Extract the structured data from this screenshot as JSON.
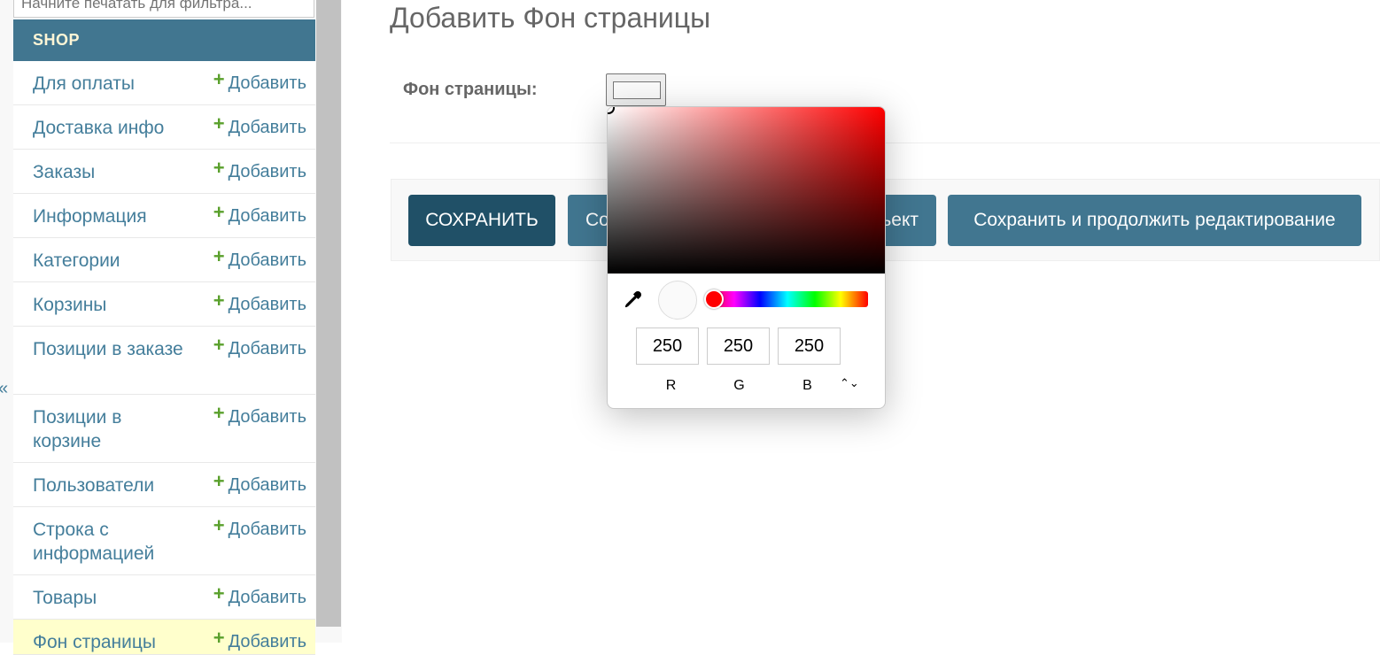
{
  "sidebar": {
    "filter_placeholder": "Начните печатать для фильтра...",
    "app_name": "SHOP",
    "add_label": "Добавить",
    "collapse_glyph": "«",
    "items": [
      {
        "label": "Для оплаты"
      },
      {
        "label": "Доставка инфо"
      },
      {
        "label": "Заказы"
      },
      {
        "label": "Информация"
      },
      {
        "label": "Категории"
      },
      {
        "label": "Корзины"
      },
      {
        "label": "Позиции в заказе"
      },
      {
        "label": "Позиции в корзине"
      },
      {
        "label": "Пользователи"
      },
      {
        "label": "Строка с информацией"
      },
      {
        "label": "Товары"
      },
      {
        "label": "Фон страницы",
        "active": true
      }
    ]
  },
  "main": {
    "title": "Добавить Фон страницы",
    "field_label": "Фон страницы:",
    "field_value": "#fafafa",
    "buttons": {
      "save": "СОХРАНИТЬ",
      "save_add_left": "Со",
      "save_add_right": "ьект",
      "save_continue": "Сохранить и продолжить редактирование"
    }
  },
  "color_picker": {
    "hue_color": "#ff0000",
    "preview_color": "#fafafa",
    "r": "250",
    "g": "250",
    "b": "250",
    "label_r": "R",
    "label_g": "G",
    "label_b": "B",
    "mode_toggle": "⌃⌄",
    "eyedropper_icon": "eyedropper-icon"
  },
  "colors": {
    "header_bg": "#417690",
    "save_bg": "#205067",
    "link": "#447e9b",
    "add_plus": "#5aa02c",
    "active_row": "#ffffcc"
  }
}
